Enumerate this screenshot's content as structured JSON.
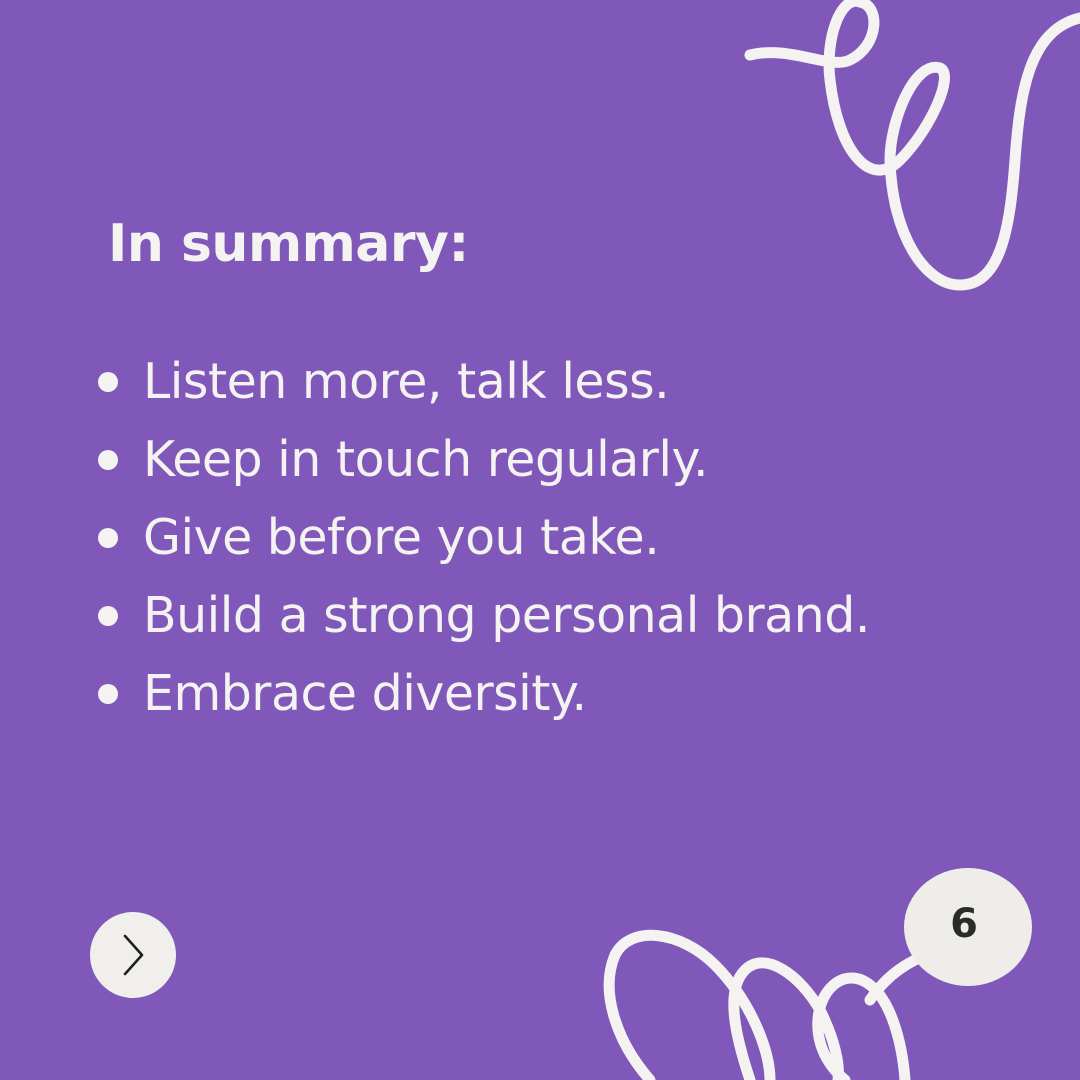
{
  "slide": {
    "heading": "In summary:",
    "bullets": [
      "Listen more, talk less.",
      "Keep in touch regularly.",
      "Give before you take.",
      "Build a strong personal brand.",
      "Embrace diversity."
    ],
    "page_number": "6"
  },
  "controls": {
    "next_icon": "chevron-right-icon"
  },
  "colors": {
    "background": "#7f58ba",
    "text": "#f4f3f2",
    "badge": "#efedea",
    "page_number": "#2b2b2b"
  }
}
